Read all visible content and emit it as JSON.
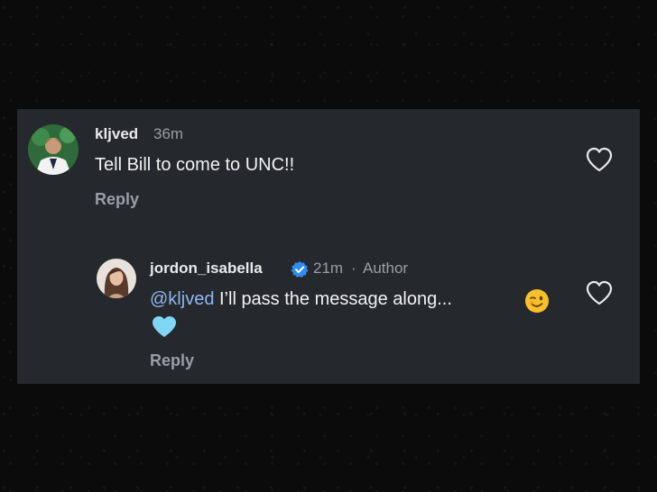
{
  "comments": [
    {
      "username": "kljved",
      "time": "36m",
      "text": "Tell Bill to come to UNC!!",
      "reply_label": "Reply"
    },
    {
      "username": "jordon_isabella",
      "time": "21m",
      "separator": "·",
      "author_label": "Author",
      "mention": "@kljved",
      "text": " I’ll pass the message along...",
      "reply_label": "Reply",
      "verified_icon": "verified-badge-icon",
      "emojis": [
        "winking-face-emoji",
        "light-blue-heart-emoji"
      ]
    }
  ],
  "colors": {
    "panel": "#25282c",
    "mention": "#8fb6f2",
    "verified": "#2f8cf0",
    "muted": "#9a9ea5"
  }
}
